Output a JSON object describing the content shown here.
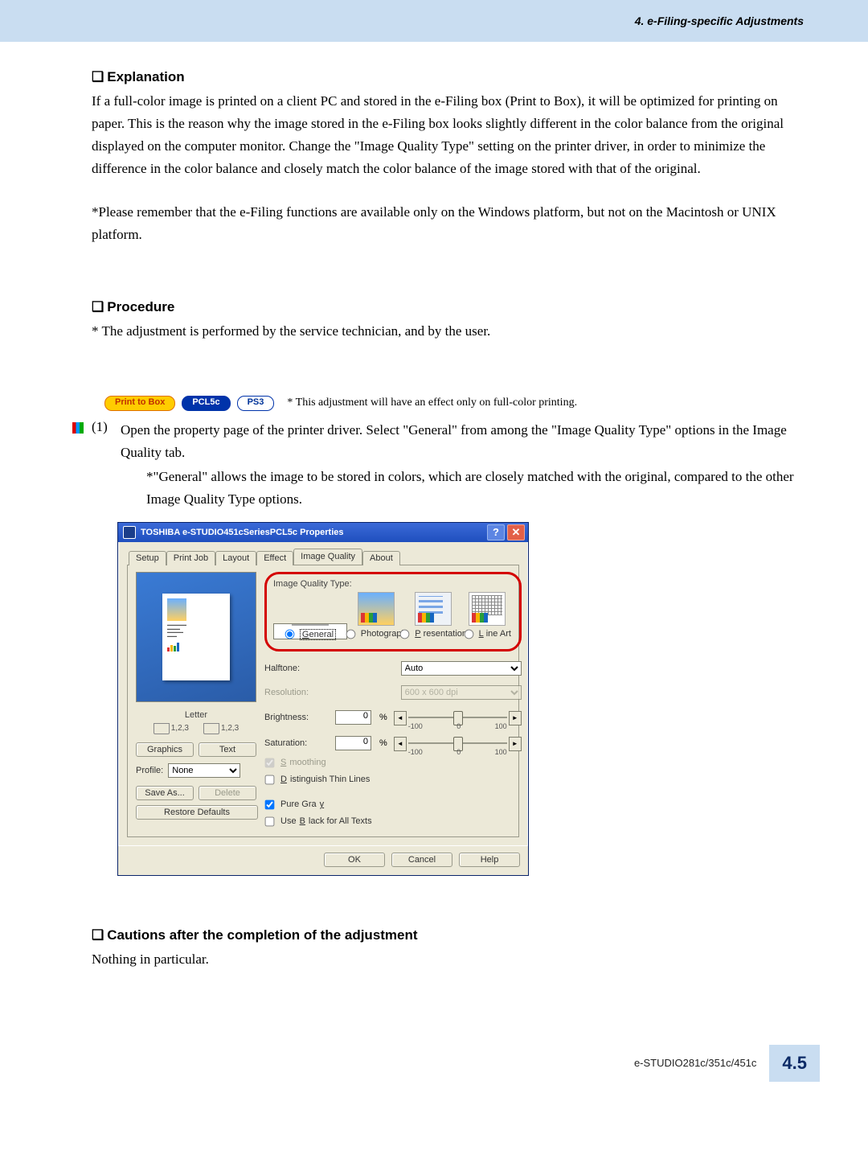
{
  "header": {
    "section": "4. e-Filing-specific Adjustments"
  },
  "explanation": {
    "heading": "Explanation",
    "body": "If a full-color image is printed on a client PC and stored in the e-Filing box (Print to Box), it will be optimized for printing on paper.  This is the reason why the image stored in the e-Filing box looks slightly different in the color balance from the original displayed on the computer monitor.  Change the \"Image Quality Type\" setting on the printer driver, in order to minimize the difference in the color balance and closely match the color balance of the image stored with that of the original.",
    "note": "*Please remember that the e-Filing functions are available only on the Windows platform, but not on the Macintosh or UNIX platform."
  },
  "procedure": {
    "heading": "Procedure",
    "body": "* The adjustment is performed by the service technician, and by the user."
  },
  "tags": {
    "print_to_box": "Print to Box",
    "pcl5c": "PCL5c",
    "ps3": "PS3",
    "note": "* This adjustment will have an effect only on full-color printing."
  },
  "step1": {
    "num": "(1)",
    "text": "Open the property page of the printer driver.  Select \"General\" from among the \"Image Quality Type\" options in the Image Quality tab.",
    "sub": "*\"General\" allows the image to be stored in colors, which are closely matched with the original, compared to the other Image Quality Type options."
  },
  "dialog": {
    "title": "TOSHIBA e-STUDIO451cSeriesPCL5c Properties",
    "help": "?",
    "close": "✕",
    "tabs": {
      "setup": "Setup",
      "printjob": "Print Job",
      "layout": "Layout",
      "effect": "Effect",
      "image_quality": "Image Quality",
      "about": "About"
    },
    "left": {
      "preview_label": "Letter",
      "printer_a": "1,2,3",
      "printer_b": "1,2,3",
      "graphics": "Graphics",
      "text": "Text",
      "profile_label": "Profile:",
      "profile_value": "None",
      "save_as": "Save As...",
      "delete": "Delete",
      "restore": "Restore Defaults"
    },
    "iqt": {
      "label": "Image Quality Type:",
      "general": "General",
      "photograph": "Photograph",
      "presentation": "Presentation",
      "lineart": "Line Art"
    },
    "halftone": {
      "label": "Halftone:",
      "value": "Auto"
    },
    "resolution": {
      "label": "Resolution:",
      "value": "600 x 600 dpi"
    },
    "brightness": {
      "label": "Brightness:",
      "value": "0",
      "unit": "%",
      "min": "-100",
      "mid": "0",
      "max": "100"
    },
    "saturation": {
      "label": "Saturation:",
      "value": "0",
      "unit": "%",
      "min": "-100",
      "mid": "0",
      "max": "100"
    },
    "checks": {
      "smoothing": "Smoothing",
      "thinlines": "Distinguish Thin Lines",
      "puregray": "Pure Gray",
      "black_text": "Use Black for All Texts"
    },
    "buttons": {
      "ok": "OK",
      "cancel": "Cancel",
      "help": "Help"
    }
  },
  "cautions": {
    "heading": "Cautions after the completion of the adjustment",
    "body": "Nothing in particular."
  },
  "footer": {
    "model": "e-STUDIO281c/351c/451c",
    "page": "4.5"
  }
}
